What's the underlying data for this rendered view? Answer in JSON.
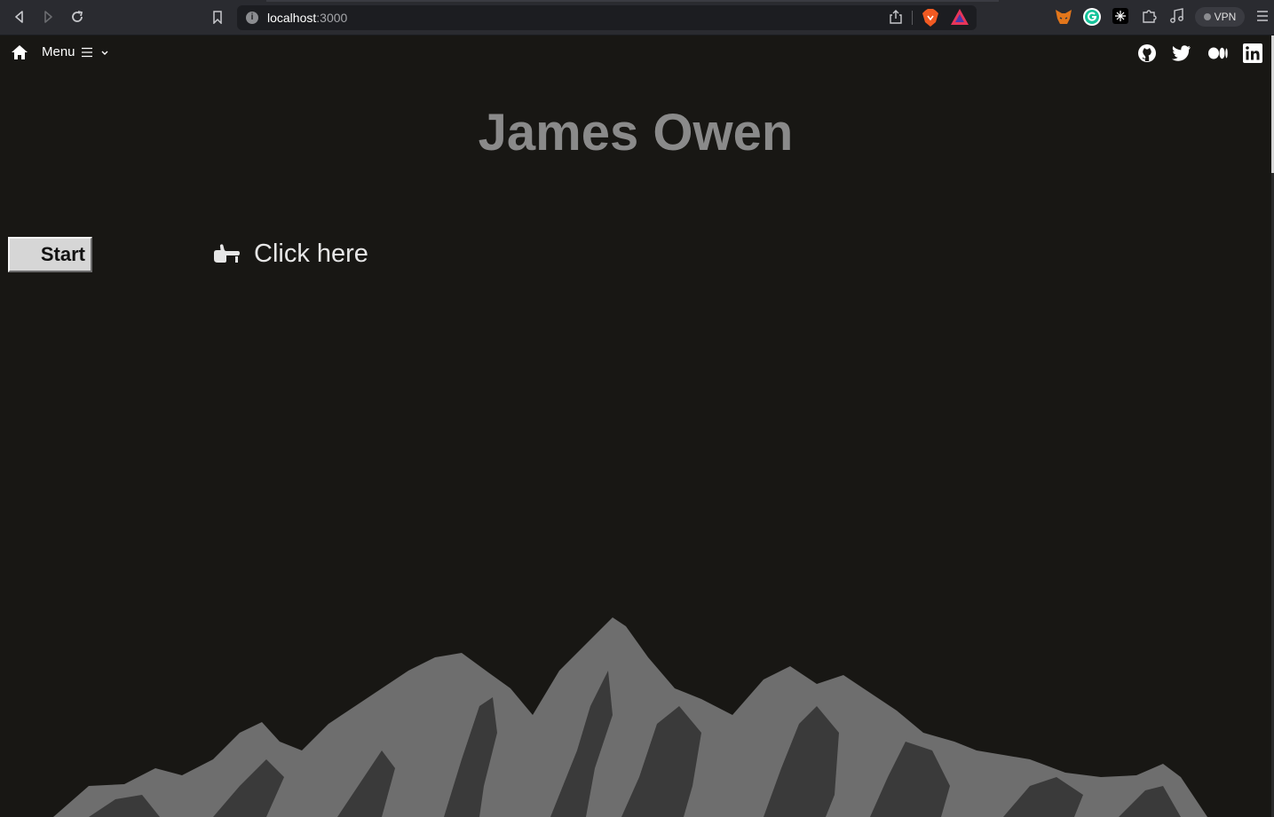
{
  "browser": {
    "url_host": "localhost",
    "url_port": ":3000",
    "vpn_label": "VPN"
  },
  "nav": {
    "menu_label": "Menu",
    "social": [
      "github-icon",
      "twitter-icon",
      "medium-icon",
      "linkedin-icon"
    ]
  },
  "hero": {
    "title": "James Owen"
  },
  "controls": {
    "start_label": "Start",
    "hint_label": "Click here"
  },
  "colors": {
    "background": "#181714",
    "title": "#8a8a8a",
    "mountain_light": "#6e6e6e",
    "mountain_dark": "#3a3a3a"
  }
}
